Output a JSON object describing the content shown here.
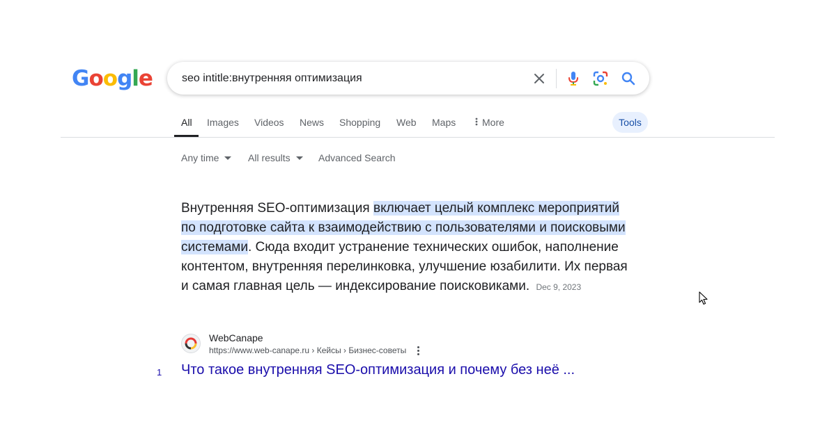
{
  "logo": {
    "letters": [
      "G",
      "o",
      "o",
      "g",
      "l",
      "e"
    ],
    "colors": [
      "#4285F4",
      "#EA4335",
      "#FBBC05",
      "#4285F4",
      "#34A853",
      "#EA4335"
    ]
  },
  "search": {
    "query": "seo intitle:внутренняя оптимизация"
  },
  "icons": {
    "clear": "close-icon",
    "voice": "microphone-icon",
    "lens": "camera-lens-icon",
    "submit": "search-icon"
  },
  "tabs": {
    "all": "All",
    "images": "Images",
    "videos": "Videos",
    "news": "News",
    "shopping": "Shopping",
    "web": "Web",
    "maps": "Maps",
    "more": "More",
    "active": "All"
  },
  "tools_label": "Tools",
  "filters": {
    "time": "Any time",
    "results": "All results",
    "advanced": "Advanced Search"
  },
  "snippet": {
    "before": "Внутренняя SEO-оптимизация ",
    "highlight": "включает целый комплекс мероприятий по подготовке сайта к взаимодействию с пользователями и поисковыми системами",
    "after": ". Сюда входит устранение технических ошибок, наполнение контентом, внутренняя перелинковка, улучшение юзабилити. Их первая и самая главная цель — индексирование поисковиками.",
    "date": "Dec 9, 2023"
  },
  "result": {
    "site_name": "WebCanape",
    "url": "https://www.web-canape.ru › Кейсы › Бизнес-советы",
    "number": "1",
    "title": "Что такое внутренняя SEO-оптимизация и почему без неё ..."
  },
  "colors": {
    "link": "#1a0dab",
    "highlight": "#d3e3fd",
    "tools_bg": "#e8f0fe"
  }
}
